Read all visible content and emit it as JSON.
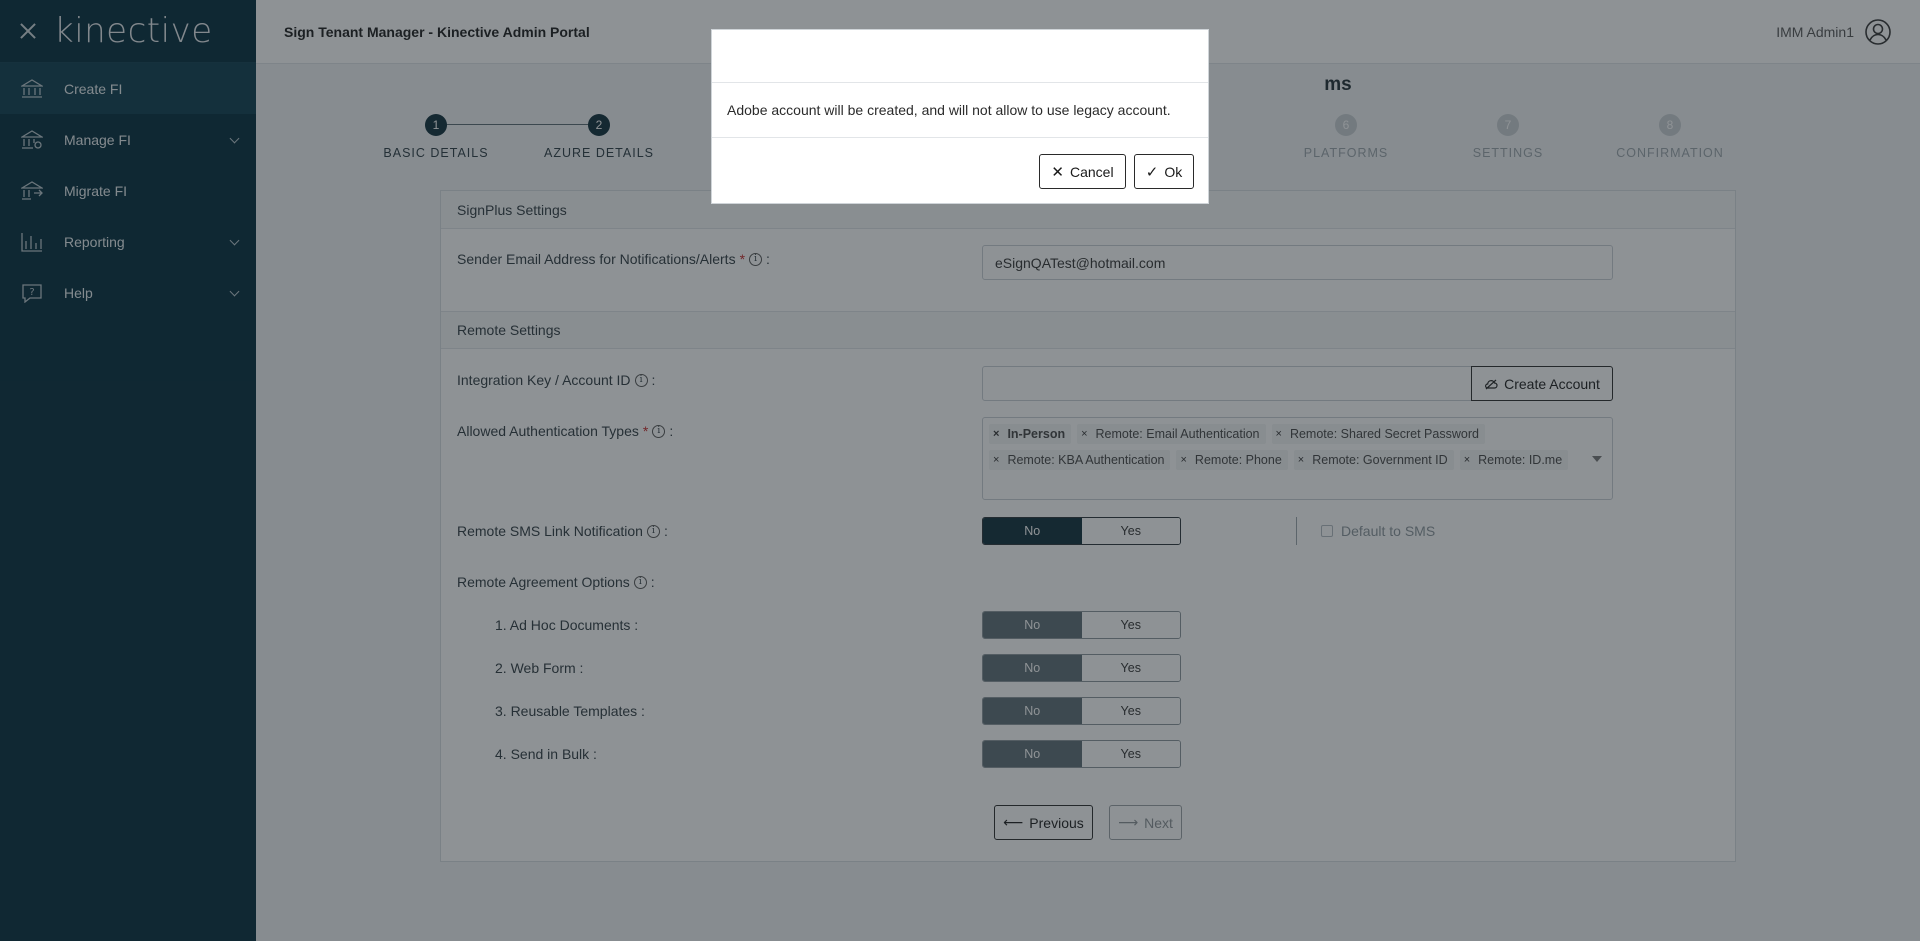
{
  "sidebar": {
    "logo": "kinective",
    "items": [
      {
        "label": "Create FI",
        "icon": "bank-icon",
        "active": true
      },
      {
        "label": "Manage FI",
        "icon": "bank-gear-icon",
        "expandable": true
      },
      {
        "label": "Migrate FI",
        "icon": "bank-transfer-icon"
      },
      {
        "label": "Reporting",
        "icon": "bar-chart-icon",
        "expandable": true
      },
      {
        "label": "Help",
        "icon": "help-icon",
        "expandable": true
      }
    ]
  },
  "topbar": {
    "title": "Sign Tenant Manager - Kinective Admin Portal",
    "user_name": "IMM Admin1"
  },
  "main": {
    "heading": "ms",
    "steps": [
      {
        "num": "1",
        "label": "BASIC DETAILS",
        "done": true
      },
      {
        "num": "2",
        "label": "AZURE DETAILS",
        "done": true
      },
      {
        "num": "6",
        "label": "PLATFORMS",
        "done": false
      },
      {
        "num": "7",
        "label": "SETTINGS",
        "done": false
      },
      {
        "num": "8",
        "label": "CONFIRMATION",
        "done": false
      }
    ],
    "signplus_section": "SignPlus Settings",
    "sender_email_label": "Sender Email Address for Notifications/Alerts",
    "sender_email_value": "eSignQATest@hotmail.com",
    "remote_section": "Remote Settings",
    "integration_key_label": "Integration Key / Account ID",
    "integration_key_value": "",
    "create_account_label": "Create Account",
    "auth_types_label": "Allowed Authentication Types",
    "auth_types": [
      "In-Person",
      "Remote: Email Authentication",
      "Remote: Shared Secret Password",
      "Remote: KBA Authentication",
      "Remote: Phone",
      "Remote: Government ID",
      "Remote: ID.me"
    ],
    "sms_label": "Remote SMS Link Notification",
    "sms_value": "No",
    "default_sms_label": "Default to SMS",
    "agreement_label": "Remote Agreement Options",
    "agreement_options": [
      {
        "label": "1. Ad Hoc Documents :",
        "value": "No"
      },
      {
        "label": "2. Web Form :",
        "value": "No"
      },
      {
        "label": "3. Reusable Templates :",
        "value": "No"
      },
      {
        "label": "4. Send in Bulk :",
        "value": "No"
      }
    ],
    "toggle_no": "No",
    "toggle_yes": "Yes",
    "previous_label": "Previous",
    "next_label": "Next"
  },
  "modal": {
    "message": "Adobe account will be created, and will not allow to use legacy account.",
    "cancel_label": "Cancel",
    "ok_label": "Ok"
  }
}
